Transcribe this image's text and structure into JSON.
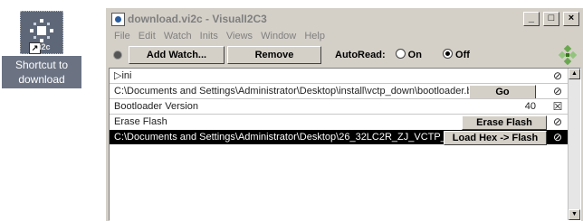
{
  "shortcut": {
    "icon_tag": "i2c",
    "label_line1": "Shortcut to",
    "label_line2": "download"
  },
  "window": {
    "title": "download.vi2c - VisualI2C3",
    "minimize": "_",
    "maximize": "□",
    "close": "×"
  },
  "menu": [
    "File",
    "Edit",
    "Watch",
    "Inits",
    "Views",
    "Window",
    "Help"
  ],
  "toolbar": {
    "add_watch": "Add Watch...",
    "remove": "Remove",
    "autoread_label": "AutoRead:",
    "on_label": "On",
    "off_label": "Off",
    "autoread_selected": "Off"
  },
  "tree": {
    "root_label": "ini",
    "expander": "▷",
    "root_status": "⊘"
  },
  "rows": [
    {
      "text": "C:\\Documents and Settings\\Administrator\\Desktop\\install\\vctp_down\\bootloader.bat",
      "button": "Go",
      "status": "⊘"
    },
    {
      "text": "Bootloader Version",
      "value": "40",
      "status": "☒"
    },
    {
      "text": "Erase Flash",
      "button": "Erase Flash",
      "status": "⊘"
    },
    {
      "text": "C:\\Documents and Settings\\Administrator\\Desktop\\26_32LC2R_ZJ_VCTP_V2.00",
      "button": "Load Hex -> Flash",
      "status": "⊘",
      "selected": true
    }
  ],
  "icons": {
    "shortcut": "chip-icon",
    "app": "app-icon",
    "brand": "diamond-logo-icon"
  },
  "colors": {
    "window_bg": "#d4d0c8",
    "selection": "#000000",
    "shortcut_label_bg": "#6b7383",
    "logo_green": "#6aa84f"
  }
}
